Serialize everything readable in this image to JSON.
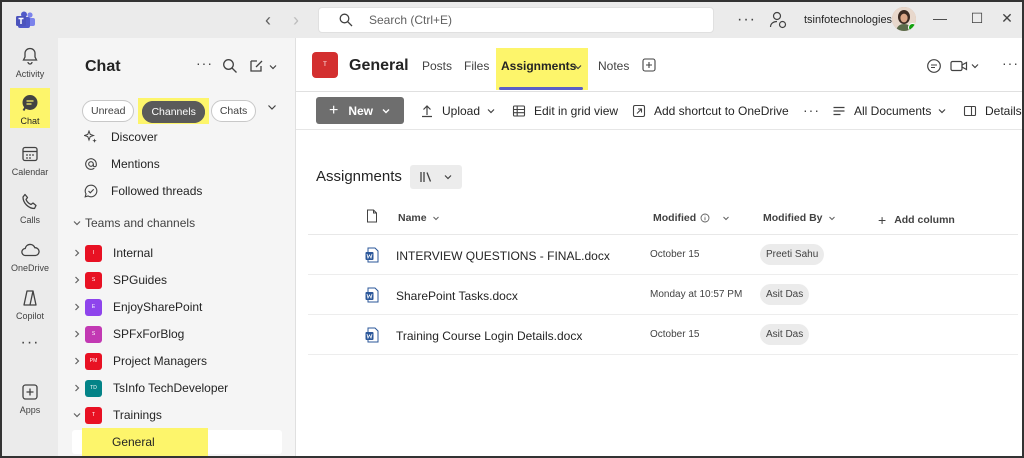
{
  "titlebar": {
    "search_placeholder": "Search (Ctrl+E)",
    "user_name": "tsinfotechnologies"
  },
  "rail": {
    "items": [
      {
        "label": "Activity",
        "icon": "bell-icon"
      },
      {
        "label": "Chat",
        "icon": "chat-icon",
        "active": true
      },
      {
        "label": "Calendar",
        "icon": "calendar-icon"
      },
      {
        "label": "Calls",
        "icon": "phone-icon"
      },
      {
        "label": "OneDrive",
        "icon": "cloud-icon"
      },
      {
        "label": "Copilot",
        "icon": "copilot-icon"
      },
      {
        "label": "Apps",
        "icon": "add-apps-icon"
      }
    ]
  },
  "sidebar": {
    "title": "Chat",
    "filters": [
      {
        "label": "Unread",
        "selected": false
      },
      {
        "label": "Channels",
        "selected": true
      },
      {
        "label": "Chats",
        "selected": false
      }
    ],
    "quick_links": [
      {
        "label": "Discover",
        "icon": "sparkle-icon"
      },
      {
        "label": "Mentions",
        "icon": "at-icon"
      },
      {
        "label": "Followed threads",
        "icon": "followed-threads-icon"
      }
    ],
    "section_label": "Teams and channels",
    "teams": [
      {
        "name": "Internal",
        "initials": "I",
        "color": "#e81123"
      },
      {
        "name": "SPGuides",
        "initials": "S",
        "color": "#e81123"
      },
      {
        "name": "EnjoySharePoint",
        "initials": "E",
        "color": "#8e44ec"
      },
      {
        "name": "SPFxForBlog",
        "initials": "S",
        "color": "#c239b3"
      },
      {
        "name": "Project Managers",
        "initials": "PM",
        "color": "#e81123"
      },
      {
        "name": "TsInfo TechDeveloper",
        "initials": "TD",
        "color": "#038387"
      },
      {
        "name": "Trainings",
        "initials": "T",
        "color": "#e81123"
      }
    ],
    "active_channel": "General"
  },
  "main": {
    "channel_title": "General",
    "channel_initials": "T",
    "tabs": [
      "Posts",
      "Files",
      "Assignments",
      "Notes"
    ],
    "active_tab": "Assignments",
    "toolbar": {
      "new_label": "New",
      "upload_label": "Upload",
      "grid_label": "Edit in grid view",
      "shortcut_label": "Add shortcut to OneDrive",
      "view_label": "All Documents",
      "details_label": "Details"
    },
    "library_title": "Assignments",
    "columns": {
      "name": "Name",
      "modified": "Modified",
      "modified_by": "Modified By",
      "add_column": "Add column"
    },
    "files": [
      {
        "name": "INTERVIEW QUESTIONS - FINAL.docx",
        "modified": "October 15",
        "modified_by": "Preeti Sahu"
      },
      {
        "name": "SharePoint Tasks.docx",
        "modified": "Monday at 10:57 PM",
        "modified_by": "Asit Das"
      },
      {
        "name": "Training Course Login Details.docx",
        "modified": "October 15",
        "modified_by": "Asit Das"
      }
    ]
  }
}
